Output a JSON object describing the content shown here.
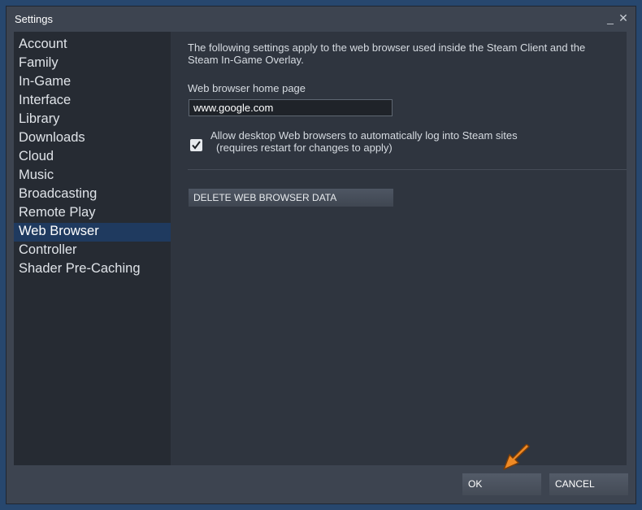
{
  "window": {
    "title": "Settings",
    "minimize_glyph": "_",
    "close_glyph": "✕"
  },
  "sidebar": {
    "items": [
      {
        "label": "Account"
      },
      {
        "label": "Family"
      },
      {
        "label": "In-Game"
      },
      {
        "label": "Interface"
      },
      {
        "label": "Library"
      },
      {
        "label": "Downloads"
      },
      {
        "label": "Cloud"
      },
      {
        "label": "Music"
      },
      {
        "label": "Broadcasting"
      },
      {
        "label": "Remote Play"
      },
      {
        "label": "Web Browser",
        "active": true
      },
      {
        "label": "Controller"
      },
      {
        "label": "Shader Pre-Caching"
      }
    ]
  },
  "content": {
    "description": "The following settings apply to the web browser used inside the Steam Client and the Steam In-Game Overlay.",
    "home_page_label": "Web browser home page",
    "home_page_value": "www.google.com",
    "auto_login_label": "Allow desktop Web browsers to automatically log into Steam sites",
    "auto_login_note": "(requires restart for changes to apply)",
    "auto_login_checked": true,
    "delete_button": "DELETE WEB BROWSER DATA"
  },
  "footer": {
    "ok_label": "OK",
    "cancel_label": "CANCEL"
  },
  "colors": {
    "accent_arrow": "#f08a24",
    "active_nav": "#1f3a5f"
  },
  "icons": {
    "pointer_arrow": "arrow-pointer-icon",
    "checkmark": "checkmark-icon"
  }
}
